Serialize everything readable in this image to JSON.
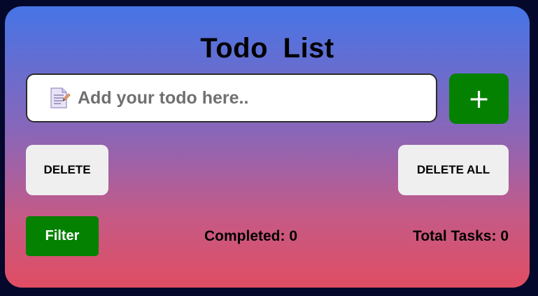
{
  "app": {
    "title": "Todo  List"
  },
  "input": {
    "icon": "notepad-icon",
    "placeholder": "Add your todo here..",
    "value": ""
  },
  "buttons": {
    "add_label": "+",
    "delete_label": "DELETE",
    "delete_all_label": "DELETE ALL",
    "filter_label": "Filter"
  },
  "stats": {
    "completed_label": "Completed: 0",
    "total_label": "Total Tasks: 0"
  },
  "colors": {
    "background": "#04082a",
    "gradient_top": "#4674e6",
    "gradient_bottom": "#e04d62",
    "primary_green": "#048100",
    "light_button": "#efefef"
  }
}
